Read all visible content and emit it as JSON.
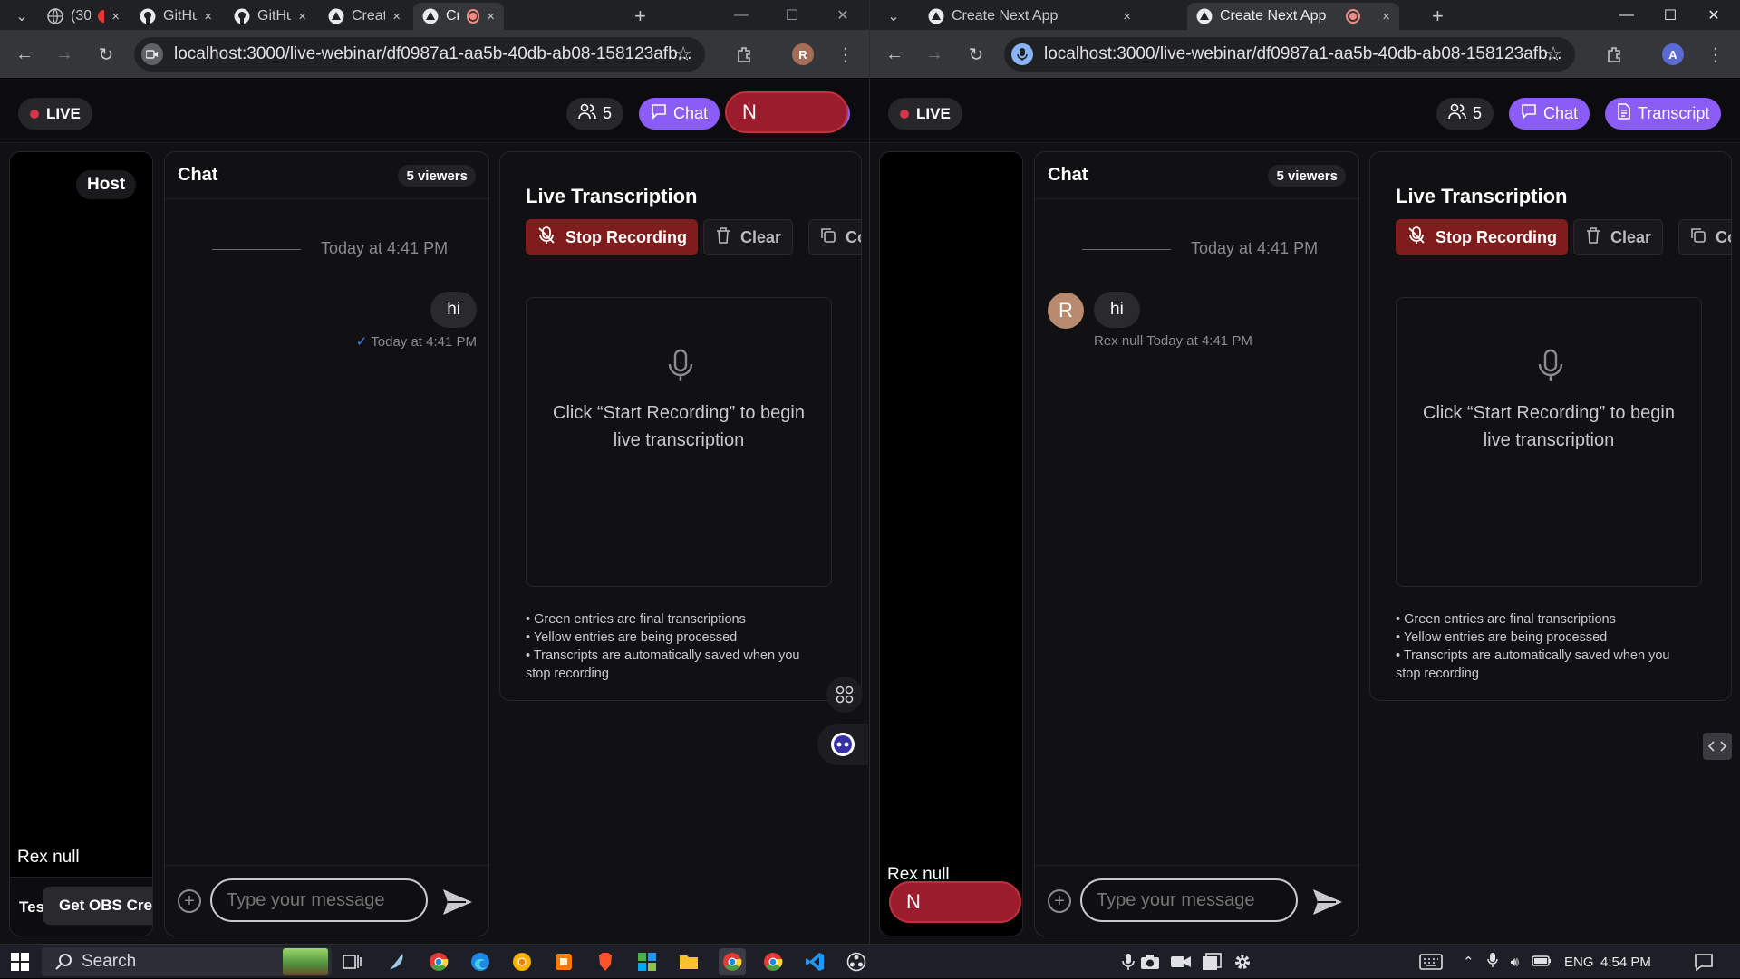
{
  "left_window": {
    "tabs": [
      {
        "label": "(30)",
        "close": "×"
      },
      {
        "label": "GitHu",
        "close": "×"
      },
      {
        "label": "GitHu",
        "close": "×"
      },
      {
        "label": "Creat",
        "close": "×"
      },
      {
        "label": "Cr",
        "close": "×",
        "active": true
      }
    ],
    "new_tab": "+",
    "url": "localhost:3000/live-webinar/df0987a1-aa5b-40db-ab08-158123afb...",
    "profile_initial": "R"
  },
  "right_window": {
    "tabs": [
      {
        "label": "Create Next App",
        "close": "×"
      },
      {
        "label": "Create Next App",
        "close": "×",
        "active": true
      }
    ],
    "new_tab": "+",
    "url": "localhost:3000/live-webinar/df0987a1-aa5b-40db-ab08-158123afb...",
    "profile_initial": "A"
  },
  "header": {
    "live_label": "LIVE",
    "viewer_count": "5",
    "chat_button": "Chat",
    "transcript_button": "Transcript"
  },
  "video": {
    "host_label": "Host",
    "participant_name": "Rex null",
    "test_label": "Tes",
    "obs_button": "Get OBS Cred"
  },
  "chat": {
    "title": "Chat",
    "viewers_badge": "5 viewers",
    "date_separator": "Today at 4:41 PM",
    "message_text": "hi",
    "sent_meta": "Today at 4:41 PM",
    "received_meta": "Rex null Today at 4:41 PM",
    "sender_initial": "R",
    "input_placeholder": "Type your message"
  },
  "transcription": {
    "title": "Live Transcription",
    "stop_button": "Stop Recording",
    "clear_button": "Clear",
    "copy_button": "Co",
    "empty_hint": "Click “Start Recording” to begin live transcription",
    "notes": [
      "• Green entries are final transcriptions",
      "• Yellow entries are being processed",
      "• Transcripts are automatically saved when you stop recording"
    ]
  },
  "overlay_badge": {
    "initial": "N"
  },
  "taskbar": {
    "search_label": "Search",
    "language": "ENG",
    "time": "4:54 PM"
  },
  "colors": {
    "accent_purple": "#8b5cf6",
    "stop_red": "#7f1d1d",
    "live_dot": "#d6344a",
    "badge_red": "#9b1c2c"
  }
}
